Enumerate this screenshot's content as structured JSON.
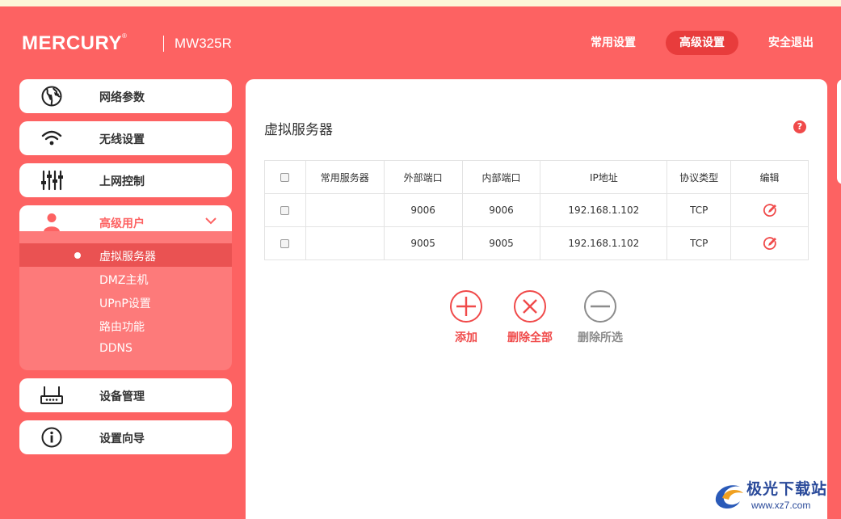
{
  "header": {
    "brand": "MERCURY",
    "brand_mark": "®",
    "model": "MW325R",
    "nav": [
      {
        "label": "常用设置",
        "active": false
      },
      {
        "label": "高级设置",
        "active": true
      },
      {
        "label": "安全退出",
        "active": false
      }
    ]
  },
  "sidebar": {
    "items": [
      {
        "label": "网络参数",
        "icon": "globe-icon"
      },
      {
        "label": "无线设置",
        "icon": "wifi-icon"
      },
      {
        "label": "上网控制",
        "icon": "sliders-icon"
      },
      {
        "label": "高级用户",
        "icon": "user-icon",
        "expanded": true
      },
      {
        "label": "设备管理",
        "icon": "router-icon"
      },
      {
        "label": "设置向导",
        "icon": "info-icon"
      }
    ],
    "subitems": [
      {
        "label": "虚拟服务器",
        "selected": true
      },
      {
        "label": "DMZ主机"
      },
      {
        "label": "UPnP设置"
      },
      {
        "label": "路由功能"
      },
      {
        "label": "DDNS"
      }
    ]
  },
  "main": {
    "title": "虚拟服务器",
    "help": "?",
    "table": {
      "headers": [
        "常用服务器",
        "外部端口",
        "内部端口",
        "IP地址",
        "协议类型",
        "编辑"
      ],
      "rows": [
        {
          "service": "",
          "ext_port": "9006",
          "int_port": "9006",
          "ip": "192.168.1.102",
          "protocol": "TCP"
        },
        {
          "service": "",
          "ext_port": "9005",
          "int_port": "9005",
          "ip": "192.168.1.102",
          "protocol": "TCP"
        }
      ]
    },
    "actions": {
      "add": "添加",
      "delete_all": "删除全部",
      "delete_selected": "删除所选"
    }
  },
  "watermark": {
    "name": "极光下载站",
    "url": "www.xz7.com"
  },
  "colors": {
    "brand": "#fd6262",
    "accent": "#f04a4a",
    "active_nav": "#e83c3c"
  }
}
